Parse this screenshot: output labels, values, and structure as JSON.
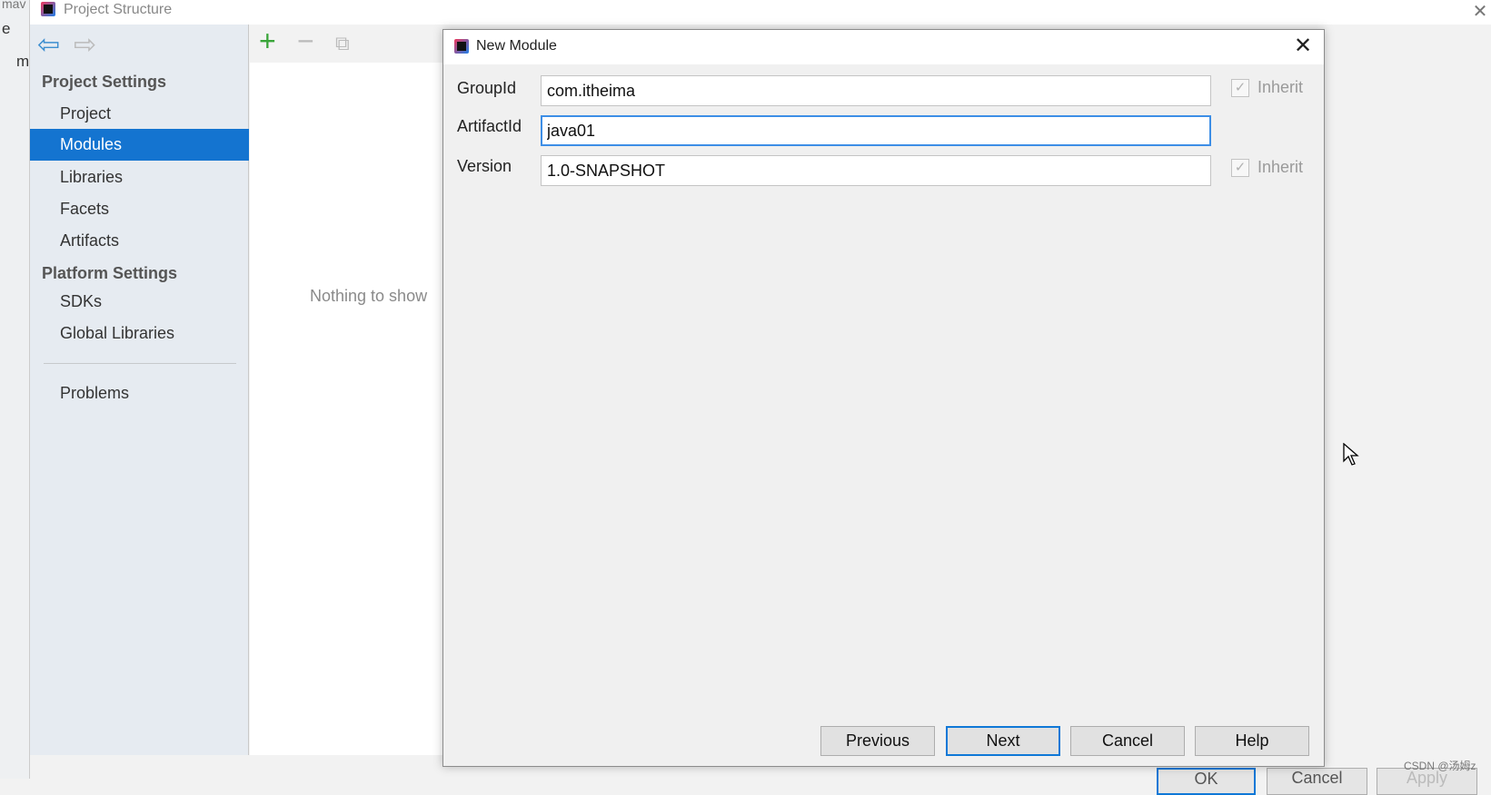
{
  "background_ide": {
    "strip_texts": [
      "mav",
      "e",
      "m"
    ]
  },
  "window": {
    "title": "Project Structure",
    "close_icon": "close-icon"
  },
  "toolbar": {
    "back_icon": "arrow-left-icon",
    "forward_icon": "arrow-right-icon",
    "add_icon": "plus-icon",
    "remove_icon": "minus-icon",
    "copy_icon": "copy-icon"
  },
  "sidebar": {
    "project_settings": "Project Settings",
    "items1": [
      {
        "label": "Project"
      },
      {
        "label": "Modules",
        "selected": true
      },
      {
        "label": "Libraries"
      },
      {
        "label": "Facets"
      },
      {
        "label": "Artifacts"
      }
    ],
    "platform_settings": "Platform Settings",
    "items2": [
      {
        "label": "SDKs"
      },
      {
        "label": "Global Libraries"
      }
    ],
    "problems": "Problems"
  },
  "main": {
    "empty_text": "Nothing to show"
  },
  "footer": {
    "ok": "OK",
    "cancel": "Cancel",
    "apply": "Apply"
  },
  "dialog": {
    "title": "New Module",
    "fields": [
      {
        "label": "GroupId",
        "value": "com.itheima",
        "inherit": "Inherit",
        "inherit_checked": true
      },
      {
        "label": "ArtifactId",
        "value": "java01"
      },
      {
        "label": "Version",
        "value": "1.0-SNAPSHOT",
        "inherit": "Inherit",
        "inherit_checked": true
      }
    ],
    "buttons": {
      "previous": "Previous",
      "next": "Next",
      "cancel": "Cancel",
      "help": "Help"
    }
  },
  "watermark": "CSDN @汤姆z",
  "colors": {
    "selection": "#1474d0",
    "focus": "#3d8ee6",
    "add": "#3aa53a"
  }
}
